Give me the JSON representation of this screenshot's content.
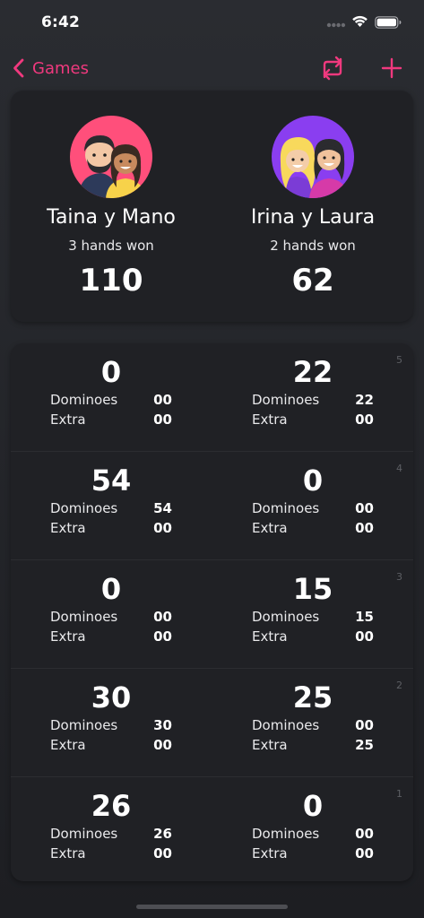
{
  "status_bar": {
    "time": "6:42"
  },
  "nav": {
    "back_label": "Games",
    "accent_color": "#f0397e",
    "icons": [
      "chevron-left-icon",
      "swap-icon",
      "plus-icon"
    ]
  },
  "summary": {
    "teams": [
      {
        "name": "Taina y Mano",
        "hands_won": "3 hands won",
        "score": "110",
        "avatar_bg": "#ff4f7b"
      },
      {
        "name": "Irina y Laura",
        "hands_won": "2 hands won",
        "score": "62",
        "avatar_bg": "#8a3ef0"
      }
    ]
  },
  "hands": {
    "dominoes_label": "Dominoes",
    "extra_label": "Extra",
    "rows": [
      {
        "number": "5",
        "left": {
          "total": "0",
          "dominoes": "00",
          "extra": "00"
        },
        "right": {
          "total": "22",
          "dominoes": "22",
          "extra": "00"
        }
      },
      {
        "number": "4",
        "left": {
          "total": "54",
          "dominoes": "54",
          "extra": "00"
        },
        "right": {
          "total": "0",
          "dominoes": "00",
          "extra": "00"
        }
      },
      {
        "number": "3",
        "left": {
          "total": "0",
          "dominoes": "00",
          "extra": "00"
        },
        "right": {
          "total": "15",
          "dominoes": "15",
          "extra": "00"
        }
      },
      {
        "number": "2",
        "left": {
          "total": "30",
          "dominoes": "30",
          "extra": "00"
        },
        "right": {
          "total": "25",
          "dominoes": "00",
          "extra": "25"
        }
      },
      {
        "number": "1",
        "left": {
          "total": "26",
          "dominoes": "26",
          "extra": "00"
        },
        "right": {
          "total": "0",
          "dominoes": "00",
          "extra": "00"
        }
      }
    ]
  }
}
